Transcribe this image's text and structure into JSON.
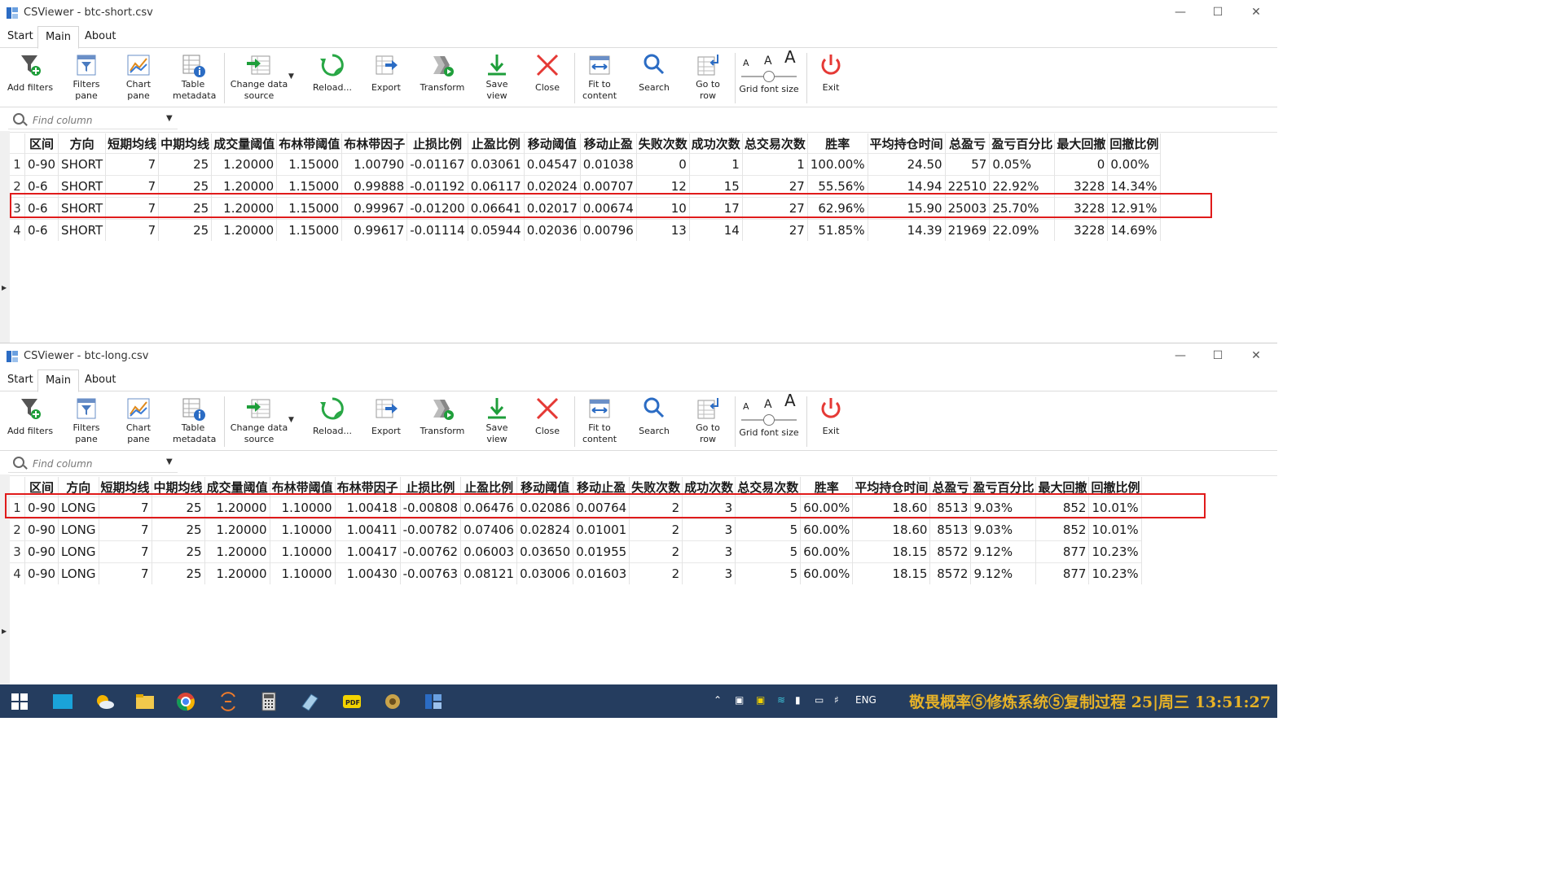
{
  "window1": {
    "title": "CSViewer - btc-short.csv",
    "menu": [
      "Start",
      "Main",
      "About"
    ],
    "find_placeholder": "Find column",
    "columns": [
      "区间",
      "方向",
      "短期均线",
      "中期均线",
      "成交量阈值",
      "布林带阈值",
      "布林带因子",
      "止损比例",
      "止盈比例",
      "移动阈值",
      "移动止盈",
      "失败次数",
      "成功次数",
      "总交易次数",
      "胜率",
      "平均持仓时间",
      "总盈亏",
      "盈亏百分比",
      "最大回撤",
      "回撤比例"
    ],
    "rows": [
      [
        "1",
        "0-90",
        "SHORT",
        "7",
        "25",
        "1.20000",
        "1.15000",
        "1.00790",
        "-0.01167",
        "0.03061",
        "0.04547",
        "0.01038",
        "0",
        "1",
        "1",
        "100.00%",
        "24.50",
        "57",
        "0.05%",
        "0",
        "0.00%"
      ],
      [
        "2",
        "0-6",
        "SHORT",
        "7",
        "25",
        "1.20000",
        "1.15000",
        "0.99888",
        "-0.01192",
        "0.06117",
        "0.02024",
        "0.00707",
        "12",
        "15",
        "27",
        "55.56%",
        "14.94",
        "22510",
        "22.92%",
        "3228",
        "14.34%"
      ],
      [
        "3",
        "0-6",
        "SHORT",
        "7",
        "25",
        "1.20000",
        "1.15000",
        "0.99967",
        "-0.01200",
        "0.06641",
        "0.02017",
        "0.00674",
        "10",
        "17",
        "27",
        "62.96%",
        "15.90",
        "25003",
        "25.70%",
        "3228",
        "12.91%"
      ],
      [
        "4",
        "0-6",
        "SHORT",
        "7",
        "25",
        "1.20000",
        "1.15000",
        "0.99617",
        "-0.01114",
        "0.05944",
        "0.02036",
        "0.00796",
        "13",
        "14",
        "27",
        "51.85%",
        "14.39",
        "21969",
        "22.09%",
        "3228",
        "14.69%"
      ]
    ]
  },
  "window2": {
    "title": "CSViewer - btc-long.csv",
    "menu": [
      "Start",
      "Main",
      "About"
    ],
    "find_placeholder": "Find column",
    "columns": [
      "区间",
      "方向",
      "短期均线",
      "中期均线",
      "成交量阈值",
      "布林带阈值",
      "布林带因子",
      "止损比例",
      "止盈比例",
      "移动阈值",
      "移动止盈",
      "失败次数",
      "成功次数",
      "总交易次数",
      "胜率",
      "平均持仓时间",
      "总盈亏",
      "盈亏百分比",
      "最大回撤",
      "回撤比例"
    ],
    "rows": [
      [
        "1",
        "0-90",
        "LONG",
        "7",
        "25",
        "1.20000",
        "1.10000",
        "1.00418",
        "-0.00808",
        "0.06476",
        "0.02086",
        "0.00764",
        "2",
        "3",
        "5",
        "60.00%",
        "18.60",
        "8513",
        "9.03%",
        "852",
        "10.01%"
      ],
      [
        "2",
        "0-90",
        "LONG",
        "7",
        "25",
        "1.20000",
        "1.10000",
        "1.00411",
        "-0.00782",
        "0.07406",
        "0.02824",
        "0.01001",
        "2",
        "3",
        "5",
        "60.00%",
        "18.60",
        "8513",
        "9.03%",
        "852",
        "10.01%"
      ],
      [
        "3",
        "0-90",
        "LONG",
        "7",
        "25",
        "1.20000",
        "1.10000",
        "1.00417",
        "-0.00762",
        "0.06003",
        "0.03650",
        "0.01955",
        "2",
        "3",
        "5",
        "60.00%",
        "18.15",
        "8572",
        "9.12%",
        "877",
        "10.23%"
      ],
      [
        "4",
        "0-90",
        "LONG",
        "7",
        "25",
        "1.20000",
        "1.10000",
        "1.00430",
        "-0.00763",
        "0.08121",
        "0.03006",
        "0.01603",
        "2",
        "3",
        "5",
        "60.00%",
        "18.15",
        "8572",
        "9.12%",
        "877",
        "10.23%"
      ]
    ]
  },
  "ribbon": {
    "add_filters": "Add filters",
    "filters_pane": "Filters\npane",
    "chart_pane": "Chart\npane",
    "table_metadata": "Table\nmetadata",
    "change_data_source": "Change data\nsource",
    "reload": "Reload...",
    "export": "Export",
    "transform": "Transform",
    "save_view": "Save\nview",
    "close": "Close",
    "fit_to_content": "Fit to\ncontent",
    "search": "Search",
    "go_to_row": "Go to\nrow",
    "grid_font_size": "Grid font size",
    "exit": "Exit",
    "font_letter": "A"
  },
  "taskbar": {
    "lang": "ENG",
    "clock": "敬畏概率⑤修炼系统⑤复制过程 25|周三 13:51:27"
  },
  "colors": {
    "highlight": "#e01b1b",
    "taskbar": "#253d5f",
    "clock": "#e7b227"
  }
}
